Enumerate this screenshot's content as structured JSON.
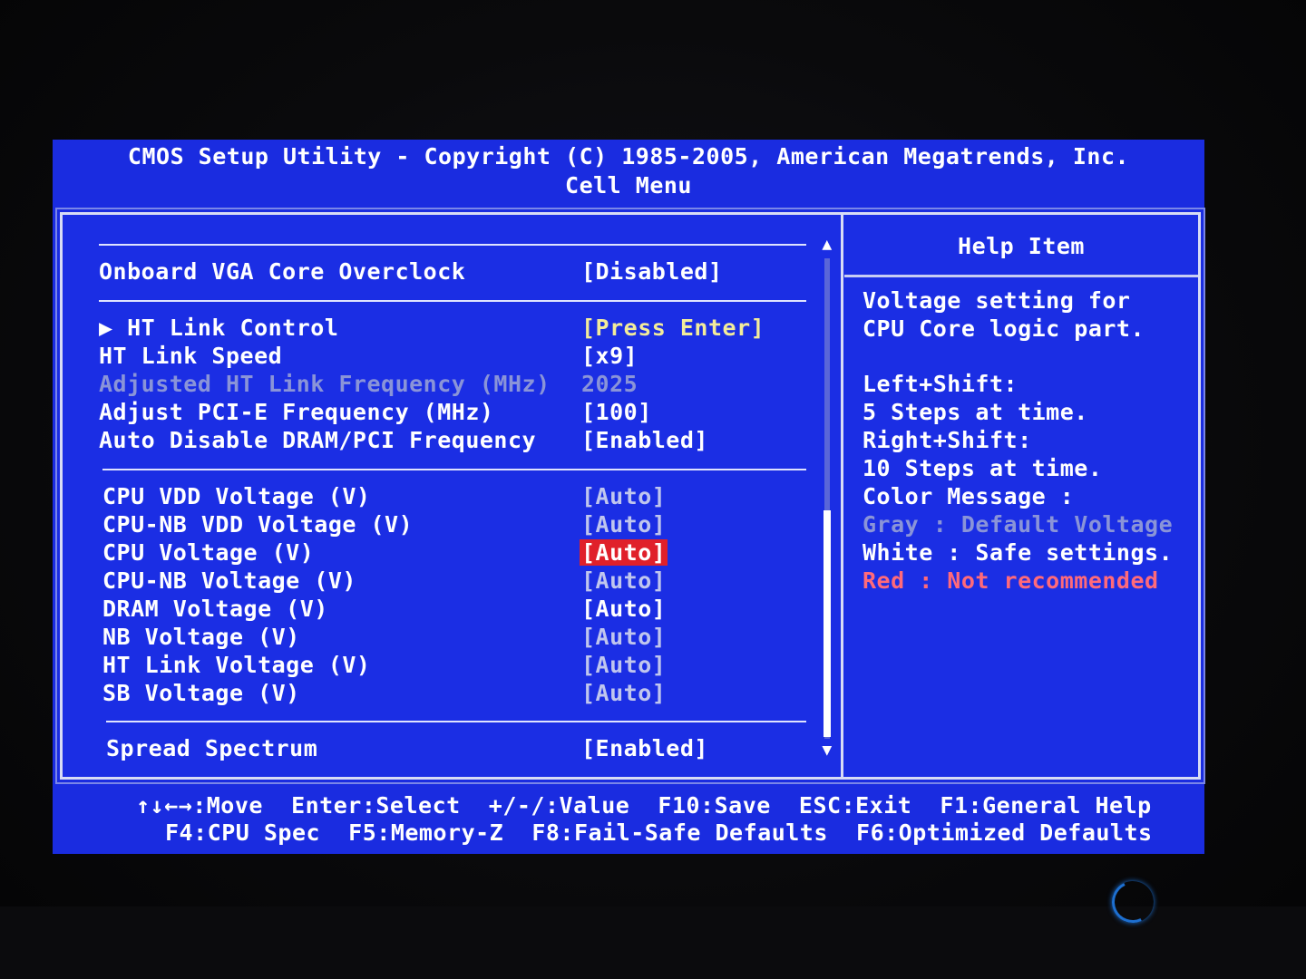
{
  "header": {
    "title": "CMOS Setup Utility - Copyright (C) 1985-2005, American Megatrends, Inc.",
    "subtitle": "Cell Menu"
  },
  "settings": {
    "onboard_vga": {
      "label": "Onboard VGA Core Overclock",
      "value": "[Disabled]"
    },
    "ht_link_control": {
      "label": "▶ HT Link Control",
      "value": "[Press Enter]"
    },
    "ht_link_speed": {
      "label": "HT Link Speed",
      "value": "[x9]"
    },
    "adjusted_ht_freq": {
      "label": "Adjusted HT Link Frequency (MHz)",
      "value": "2025"
    },
    "pcie_freq": {
      "label": "Adjust PCI-E Frequency (MHz)",
      "value": "[100]"
    },
    "auto_disable_dram": {
      "label": "Auto Disable DRAM/PCI Frequency",
      "value": "[Enabled]"
    },
    "cpu_vdd": {
      "label": "CPU VDD Voltage (V)",
      "value": "[Auto]"
    },
    "cpu_nb_vdd": {
      "label": "CPU-NB VDD Voltage (V)",
      "value": "[Auto]"
    },
    "cpu_voltage": {
      "label": "CPU Voltage (V)",
      "value": "[Auto]"
    },
    "cpu_nb_voltage": {
      "label": "CPU-NB Voltage (V)",
      "value": "[Auto]"
    },
    "dram_voltage": {
      "label": "DRAM Voltage (V)",
      "value": "[Auto]"
    },
    "nb_voltage": {
      "label": "NB Voltage (V)",
      "value": "[Auto]"
    },
    "ht_link_voltage": {
      "label": "HT Link Voltage (V)",
      "value": "[Auto]"
    },
    "sb_voltage": {
      "label": "SB Voltage (V)",
      "value": "[Auto]"
    },
    "spread_spectrum": {
      "label": "Spread Spectrum",
      "value": "[Enabled]"
    }
  },
  "help": {
    "title": "Help Item",
    "lines": [
      "Voltage setting for",
      "CPU Core logic part.",
      "Left+Shift:",
      "5 Steps at time.",
      "Right+Shift:",
      "10 Steps at time.",
      "Color Message :",
      "Gray : Default Voltage",
      "White : Safe settings.",
      "Red : Not recommended"
    ]
  },
  "footer": {
    "line1": "↑↓←→:Move  Enter:Select  +/-/:Value  F10:Save  ESC:Exit  F1:General Help",
    "line2": "F4:CPU Spec  F5:Memory-Z  F8:Fail-Safe Defaults  F6:Optimized Defaults"
  },
  "colors": {
    "screen_bg": "#1a2ce0",
    "selected_bg": "#e0202a",
    "default_gray": "#8a94d8",
    "highlight_yellow": "#f3ec9a",
    "not_recommended_red": "#ff6a7a"
  },
  "icons": {
    "submenu": "triangle-right-icon",
    "scroll_up": "arrow-up-icon",
    "scroll_down": "arrow-down-icon",
    "power": "power-led-icon"
  }
}
